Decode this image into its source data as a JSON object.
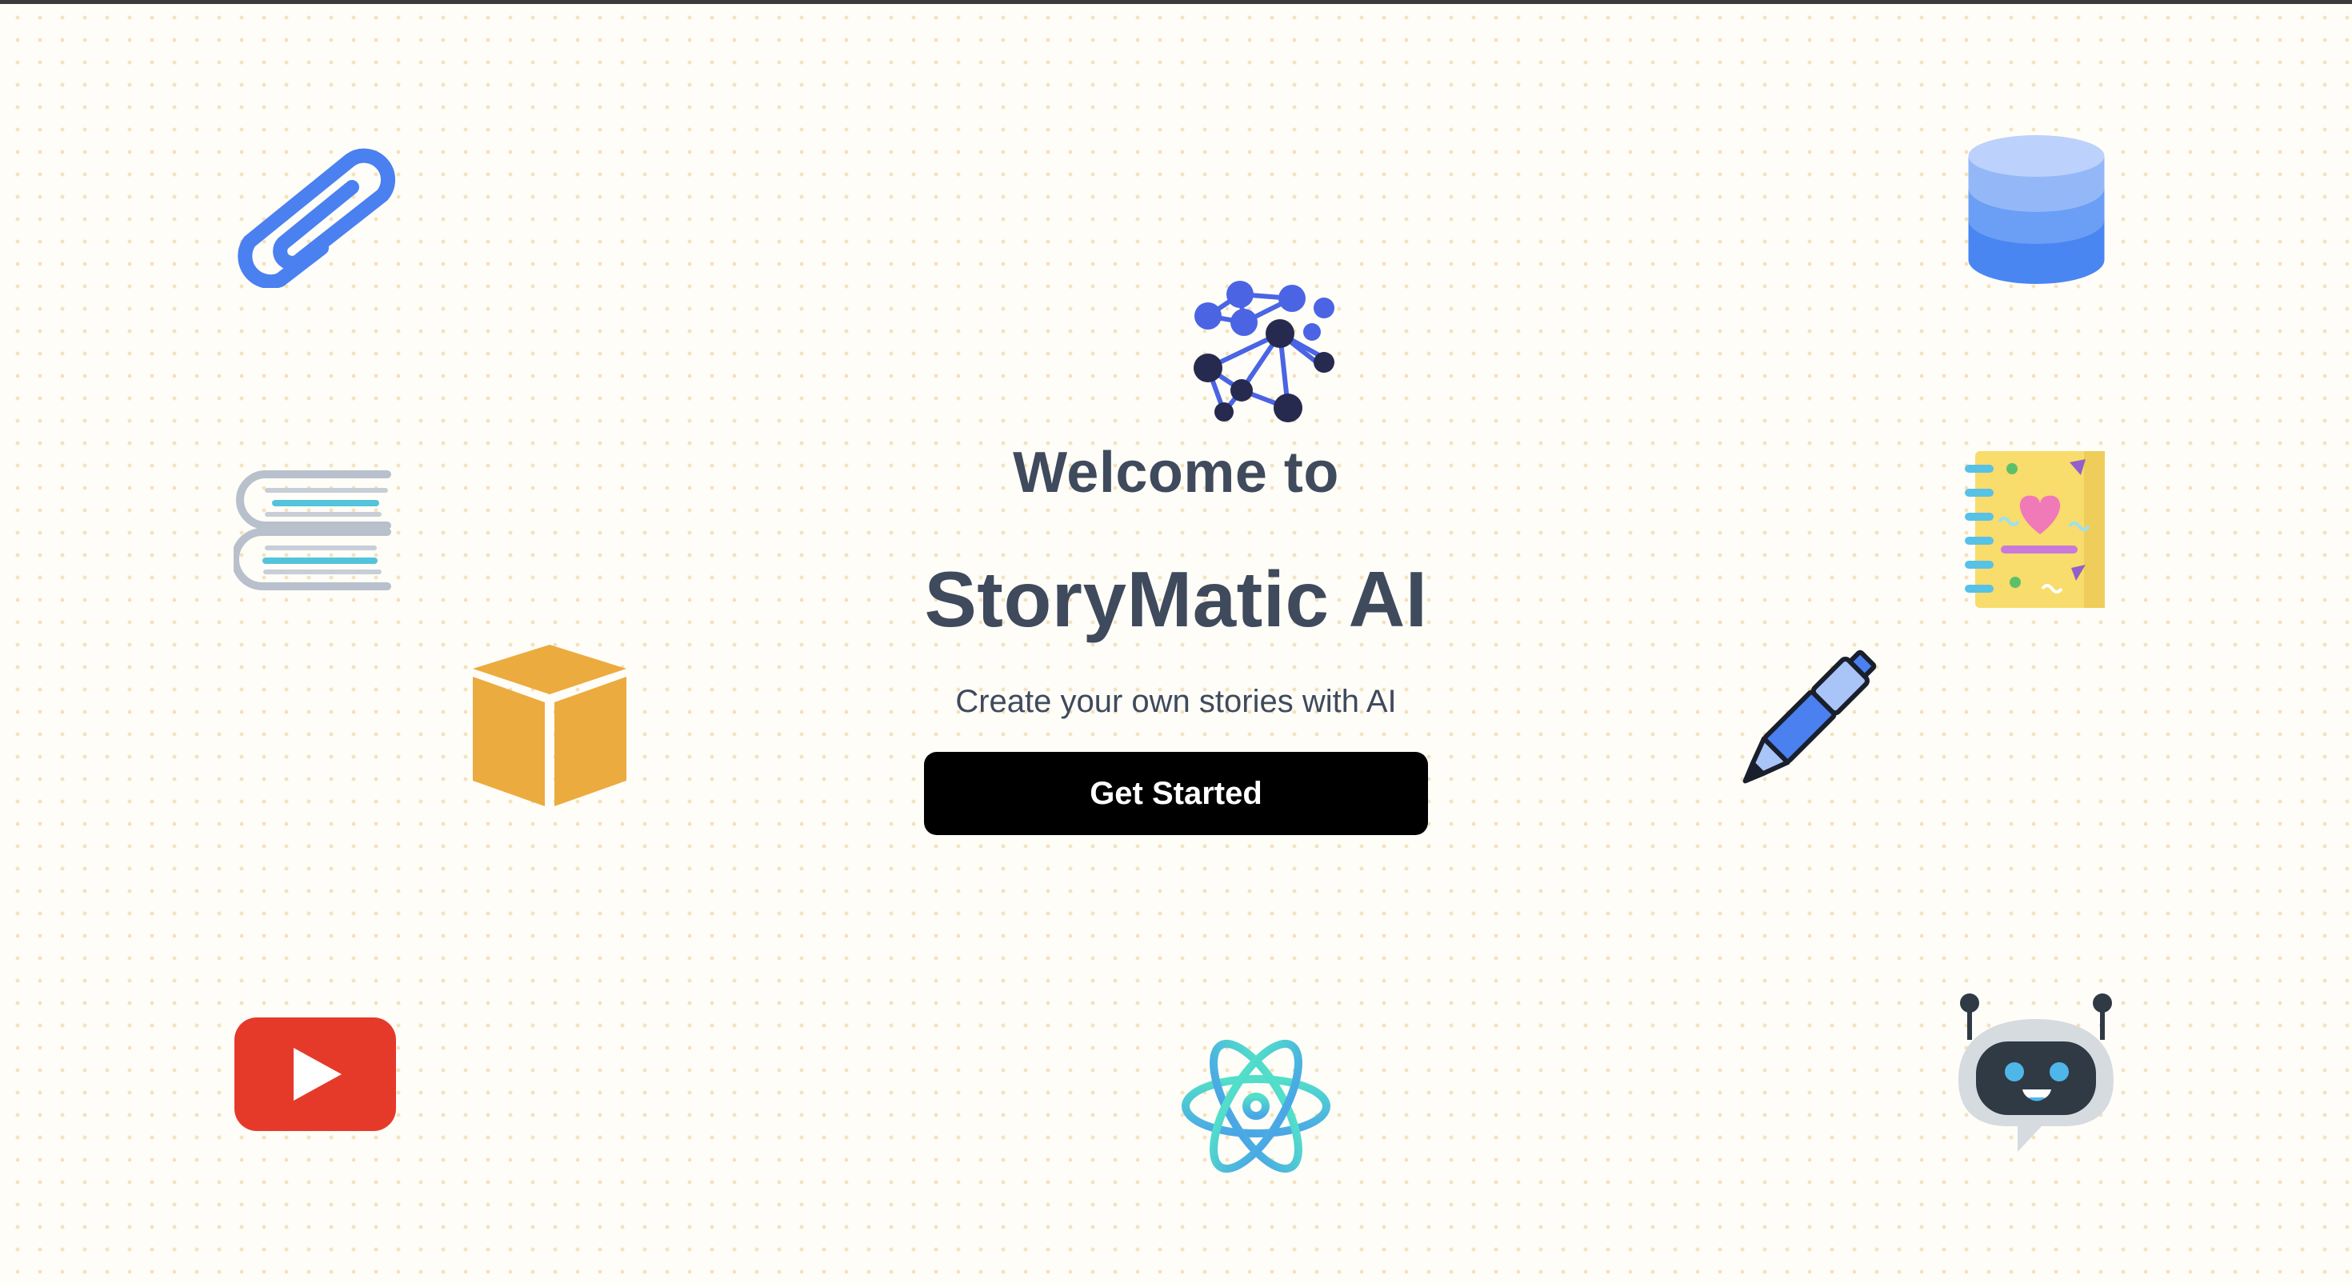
{
  "hero": {
    "welcome": "Welcome to",
    "brand": "StoryMatic AI",
    "subtitle": "Create your own stories with AI",
    "cta_label": "Get Started"
  },
  "icons": [
    "paperclip-icon",
    "books-icon",
    "box-icon",
    "youtube-icon",
    "neural-network-icon",
    "atom-icon",
    "database-icon",
    "notebook-icon",
    "pen-icon",
    "robot-icon"
  ],
  "colors": {
    "background": "#fffdf8",
    "dot": "#f3e2bf",
    "text": "#3f4a5c",
    "button": "#000000",
    "button_text": "#ffffff",
    "accent_blue": "#4a80f0",
    "youtube_red": "#e53a2a",
    "box_orange": "#ecab3f"
  }
}
